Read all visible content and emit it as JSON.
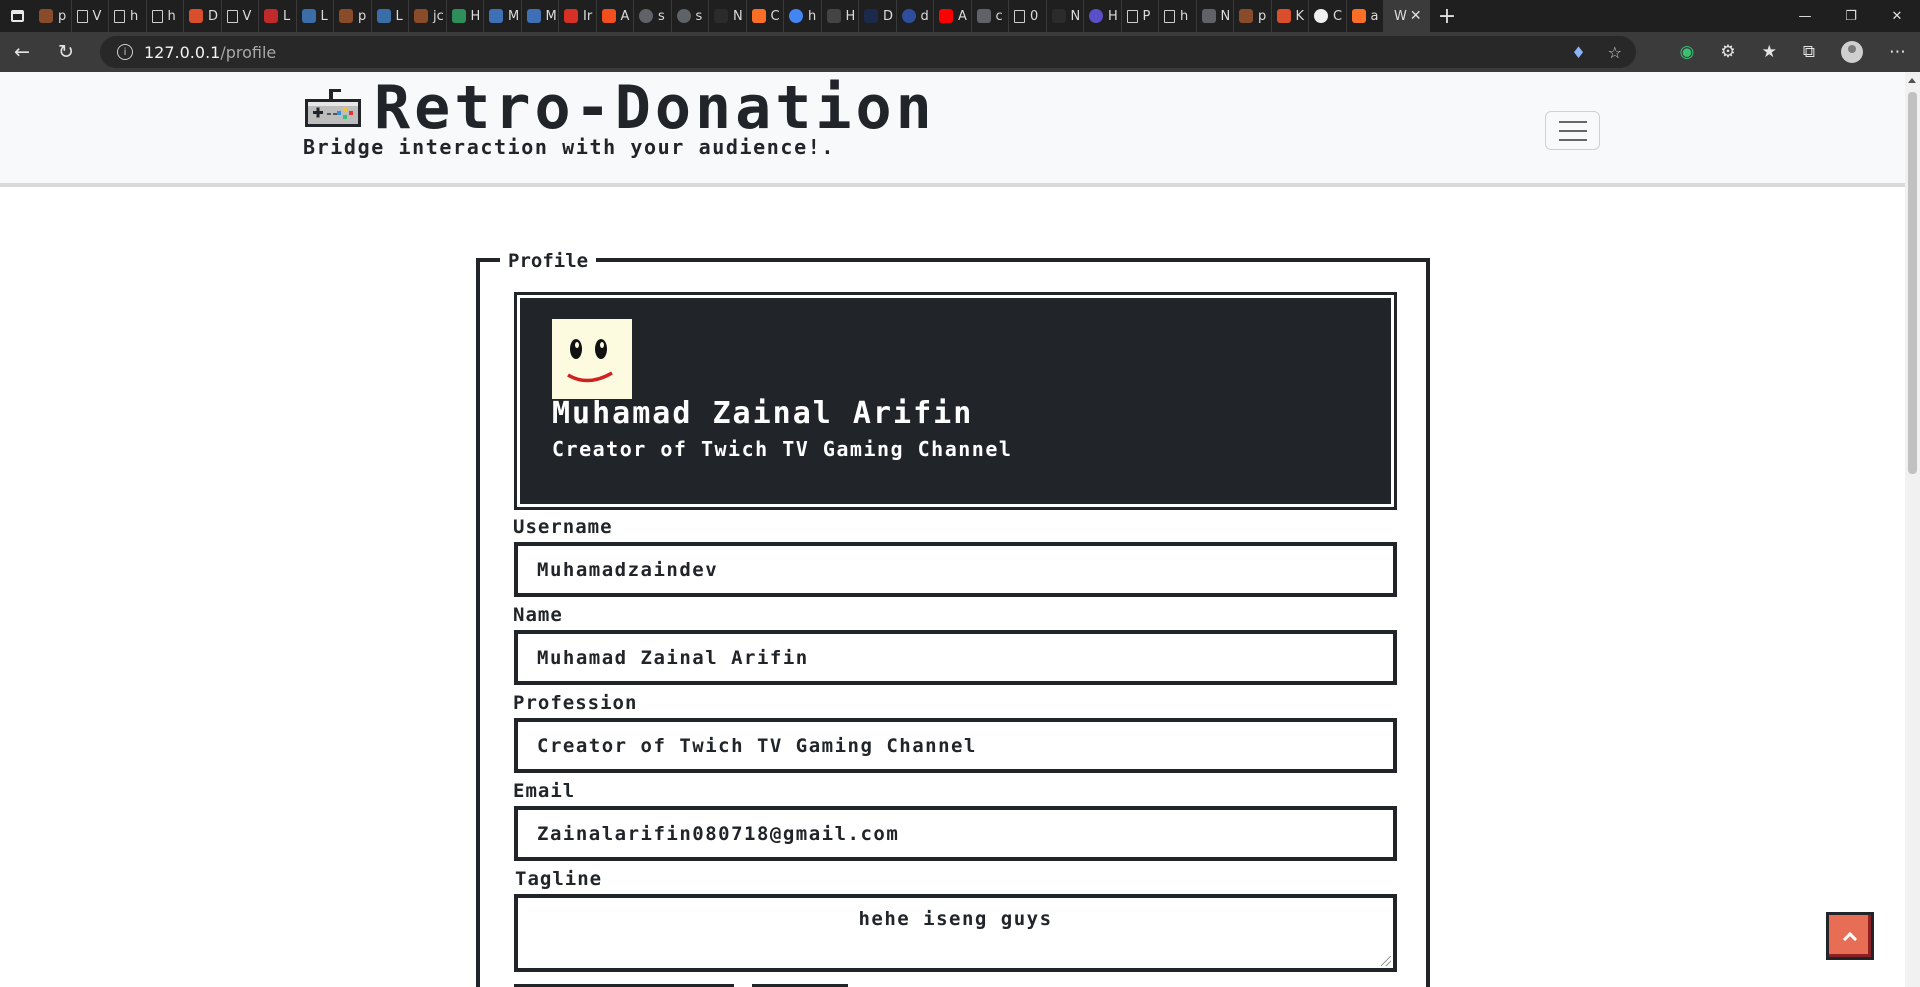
{
  "browser": {
    "tabs": [
      {
        "label": "p",
        "icon": "warbler-icon",
        "color": "#8a4b2a"
      },
      {
        "label": "V",
        "icon": "page-icon",
        "color": ""
      },
      {
        "label": "h",
        "icon": "page-icon",
        "color": ""
      },
      {
        "label": "h",
        "icon": "page-icon",
        "color": ""
      },
      {
        "label": "D",
        "icon": "chart-icon",
        "color": "#d94f2b"
      },
      {
        "label": "V",
        "icon": "page-icon",
        "color": ""
      },
      {
        "label": "L",
        "icon": "laravel-icon",
        "color": "#c02a2a"
      },
      {
        "label": "L",
        "icon": "sketch-icon",
        "color": "#3b6ea8"
      },
      {
        "label": "p",
        "icon": "warbler-icon",
        "color": "#8a4b2a"
      },
      {
        "label": "L",
        "icon": "sketch-icon",
        "color": "#3b6ea8"
      },
      {
        "label": "jc",
        "icon": "warbler-icon",
        "color": "#8a4b2a"
      },
      {
        "label": "H",
        "icon": "terminal-icon",
        "color": "#2f8f5b"
      },
      {
        "label": "M",
        "icon": "bars-icon",
        "color": "#3f6fb5"
      },
      {
        "label": "M",
        "icon": "bars-icon",
        "color": "#3f6fb5"
      },
      {
        "label": "Ir",
        "icon": "gmail-icon",
        "color": "#d93025"
      },
      {
        "label": "A",
        "icon": "figma-icon",
        "color": "#f24e1e"
      },
      {
        "label": "s",
        "icon": "ring-icon",
        "color": "#5f6368"
      },
      {
        "label": "s",
        "icon": "ring-icon",
        "color": "#5f6368"
      },
      {
        "label": "N",
        "icon": "dark-icon",
        "color": "#2b2b2b"
      },
      {
        "label": "C",
        "icon": "gitlab-icon",
        "color": "#fc6d26"
      },
      {
        "label": "h",
        "icon": "google-icon",
        "color": "#4285f4"
      },
      {
        "label": "H",
        "icon": "dots-icon",
        "color": "#444444"
      },
      {
        "label": "D",
        "icon": "dark-icon",
        "color": "#1b2a4a"
      },
      {
        "label": "d",
        "icon": "ring-icon",
        "color": "#2e4d9c"
      },
      {
        "label": "A",
        "icon": "youtube-icon",
        "color": "#ff0000"
      },
      {
        "label": "c",
        "icon": "lock-icon",
        "color": "#5f6368"
      },
      {
        "label": "0",
        "icon": "page-icon",
        "color": ""
      },
      {
        "label": "N",
        "icon": "dark-icon",
        "color": "#2b2b2b"
      },
      {
        "label": "H",
        "icon": "ring-icon",
        "color": "#5b4fc9"
      },
      {
        "label": "P",
        "icon": "page-icon",
        "color": ""
      },
      {
        "label": "h",
        "icon": "page-icon",
        "color": ""
      },
      {
        "label": "N",
        "icon": "link-icon",
        "color": "#5f6368"
      },
      {
        "label": "p",
        "icon": "warbler-icon",
        "color": "#8a4b2a"
      },
      {
        "label": "K",
        "icon": "chart-icon",
        "color": "#d94f2b"
      },
      {
        "label": "C",
        "icon": "github-icon",
        "color": "#f0f0f0"
      },
      {
        "label": "a",
        "icon": "gitlab-icon",
        "color": "#fc6d26"
      }
    ],
    "active_tab": {
      "label": "W"
    },
    "url_host": "127.0.0.1",
    "url_path": "/profile"
  },
  "site": {
    "title": "Retro-Donation",
    "tagline": "Bridge interaction with your audience!."
  },
  "profile": {
    "legend": "Profile",
    "card_name": "Muhamad Zainal Arifin",
    "card_profession": "Creator of Twich TV Gaming Channel",
    "fields": {
      "username": {
        "label": "Username",
        "value": "Muhamadzaindev"
      },
      "name": {
        "label": "Name",
        "value": "Muhamad Zainal Arifin"
      },
      "profession": {
        "label": "Profession",
        "value": "Creator of Twich TV Gaming Channel"
      },
      "email": {
        "label": "Email",
        "value": "Zainalarifin080718@gmail.com"
      },
      "tagline": {
        "label": "Tagline",
        "value": "hehe iseng guys"
      }
    }
  },
  "colors": {
    "card_background": "#212529",
    "avatar_background": "#fcfbe0",
    "primary_button": "#3c6fd6",
    "back_to_top": "#e76e55"
  }
}
